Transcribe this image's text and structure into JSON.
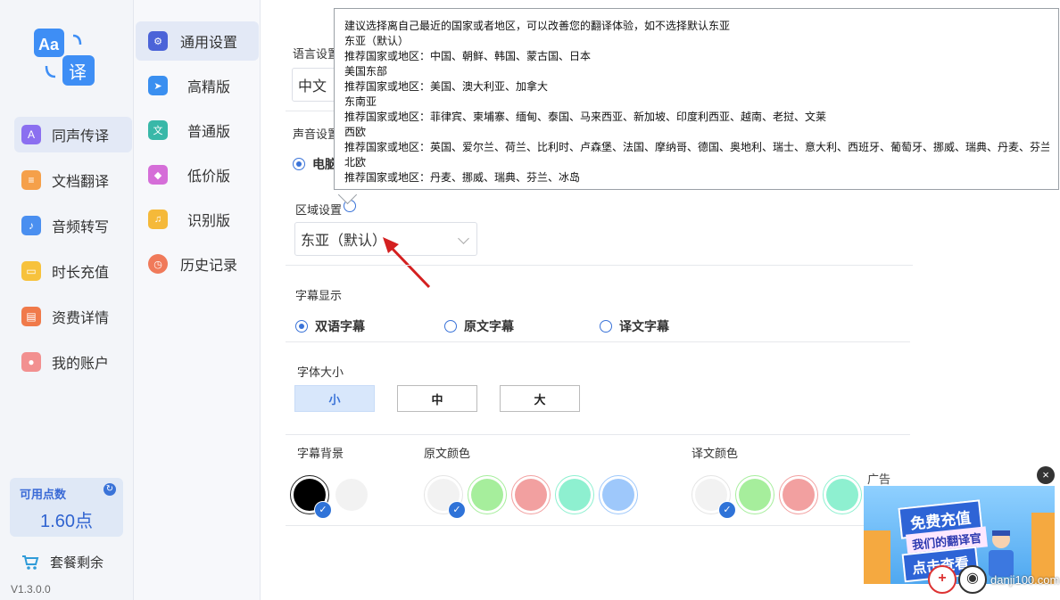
{
  "sidebar": {
    "items": [
      {
        "label": "同声传译",
        "icon": "simultaneous-translate-icon",
        "color": "#8b6ff0",
        "active": true
      },
      {
        "label": "文档翻译",
        "icon": "document-icon",
        "color": "#f5a04a"
      },
      {
        "label": "音频转写",
        "icon": "folder-audio-icon",
        "color": "#4a8ff0"
      },
      {
        "label": "时长充值",
        "icon": "wallet-icon",
        "color": "#f7c23c"
      },
      {
        "label": "资费详情",
        "icon": "ticket-icon",
        "color": "#f07a4a"
      },
      {
        "label": "我的账户",
        "icon": "user-icon",
        "color": "#f29090"
      }
    ],
    "points": {
      "title": "可用点数",
      "value": "1.60点"
    },
    "package_label": "套餐剩余",
    "version": "V1.3.0.0"
  },
  "subnav": {
    "items": [
      {
        "label": "通用设置",
        "icon": "gear-icon",
        "color": "#4b63d8",
        "active": true
      },
      {
        "label": "高精版",
        "icon": "rocket-icon",
        "color": "#3a8ff0"
      },
      {
        "label": "普通版",
        "icon": "translate-icon",
        "color": "#39b8a8"
      },
      {
        "label": "低价版",
        "icon": "tag-icon",
        "color": "#d56ed8"
      },
      {
        "label": "识别版",
        "icon": "microphone-icon",
        "color": "#f5b93a"
      },
      {
        "label": "历史记录",
        "icon": "clock-icon",
        "color": "#f07a5a"
      }
    ]
  },
  "settings": {
    "language_label": "语言设置",
    "language_value": "中文（",
    "sound_label": "声音设置",
    "sound_option": "电脑",
    "region_label": "区域设置",
    "region_value": "东亚（默认）",
    "subtitle_label": "字幕显示",
    "subtitle_options": [
      "双语字幕",
      "原文字幕",
      "译文字幕"
    ],
    "font_size_label": "字体大小",
    "font_sizes": [
      "小",
      "中",
      "大"
    ],
    "bg_label": "字幕背景",
    "source_color_label": "原文颜色",
    "target_color_label": "译文颜色",
    "bg_colors": [
      "#000000",
      "#f2f2f2"
    ],
    "source_colors": [
      "#f2f2f2",
      "#a6ee9c",
      "#f2a0a0",
      "#8ef0d0",
      "#9ec8fb"
    ],
    "target_colors": [
      "#f2f2f2",
      "#a6ee9c",
      "#f2a0a0",
      "#8ef0d0"
    ]
  },
  "tooltip": {
    "lines": [
      "建议选择离自己最近的国家或者地区，可以改善您的翻译体验，如不选择默认东亚",
      "东亚（默认）",
      "推荐国家或地区：中国、朝鲜、韩国、蒙古国、日本",
      "美国东部",
      "推荐国家或地区：美国、澳大利亚、加拿大",
      "东南亚",
      "推荐国家或地区：菲律宾、柬埔寨、缅甸、泰国、马来西亚、新加坡、印度利西亚、越南、老挝、文莱",
      "西欧",
      "推荐国家或地区：英国、爱尔兰、荷兰、比利时、卢森堡、法国、摩纳哥、德国、奥地利、瑞士、意大利、西班牙、葡萄牙、挪威、瑞典、丹麦、芬兰、",
      "北欧",
      "推荐国家或地区：丹麦、挪威、瑞典、芬兰、冰岛"
    ]
  },
  "ad": {
    "label": "广告",
    "line1": "免费充值",
    "line2": "我们的翻译官",
    "line3": "点击查看",
    "watermark": "danji100.com"
  }
}
